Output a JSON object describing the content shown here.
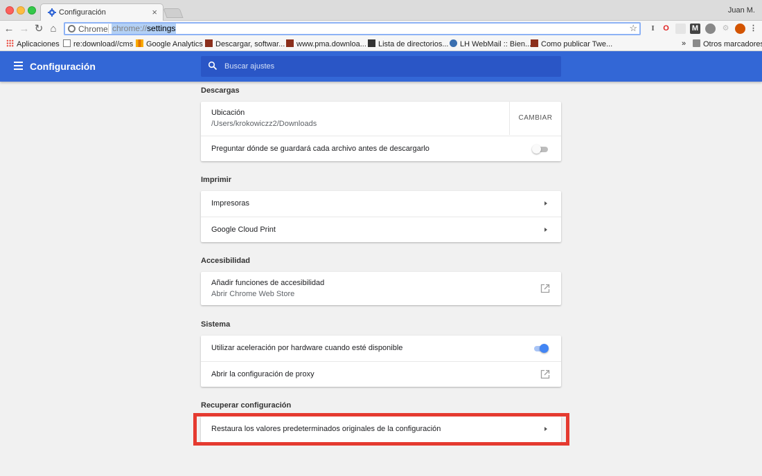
{
  "window": {
    "tab_title": "Configuración",
    "tab_close": "×",
    "profile": "Juan M."
  },
  "omnibox": {
    "chip": "Chrome",
    "url_scheme": "chrome://",
    "url_host": "settings",
    "star": "☆"
  },
  "nav": {
    "back": "←",
    "forward": "→",
    "reload": "↻",
    "home": "⌂"
  },
  "extensions": [
    "I",
    "O",
    "",
    "M",
    "",
    "",
    "",
    "⋮"
  ],
  "bookmarks": [
    {
      "label": "Aplicaciones",
      "icon": "apps-grid-icon"
    },
    {
      "label": "re:download//cms",
      "icon": "page-icon"
    },
    {
      "label": "Google Analytics",
      "icon": "analytics-icon"
    },
    {
      "label": "Descargar, softwar...",
      "icon": "site-icon"
    },
    {
      "label": "www.pma.downloa...",
      "icon": "site-icon"
    },
    {
      "label": "Lista de directorios...",
      "icon": "site-icon"
    },
    {
      "label": "LH WebMail :: Bien...",
      "icon": "mail-icon"
    },
    {
      "label": "Como publicar Twe...",
      "icon": "site-icon"
    }
  ],
  "bookmarks_more": "»",
  "other_bookmarks": "Otros marcadores",
  "header": {
    "title": "Configuración",
    "search_placeholder": "Buscar ajustes"
  },
  "sections": {
    "descargas": {
      "title": "Descargas",
      "location_label": "Ubicación",
      "location_path": "/Users/krokowiczz2/Downloads",
      "change_button": "CAMBIAR",
      "ask_label": "Preguntar dónde se guardará cada archivo antes de descargarlo",
      "ask_enabled": false
    },
    "imprimir": {
      "title": "Imprimir",
      "printers": "Impresoras",
      "cloud_print": "Google Cloud Print"
    },
    "accesibilidad": {
      "title": "Accesibilidad",
      "add_features": "Añadir funciones de accesibilidad",
      "open_store": "Abrir Chrome Web Store"
    },
    "sistema": {
      "title": "Sistema",
      "hw_accel": "Utilizar aceleración por hardware cuando esté disponible",
      "hw_accel_enabled": true,
      "proxy": "Abrir la configuración de proxy"
    },
    "recuperar": {
      "title": "Recuperar configuración",
      "restore": "Restaura los valores predeterminados originales de la configuración"
    }
  },
  "colors": {
    "header_blue": "#3367d6",
    "highlight_red": "#e53a30",
    "toggle_on": "#4285f4"
  }
}
